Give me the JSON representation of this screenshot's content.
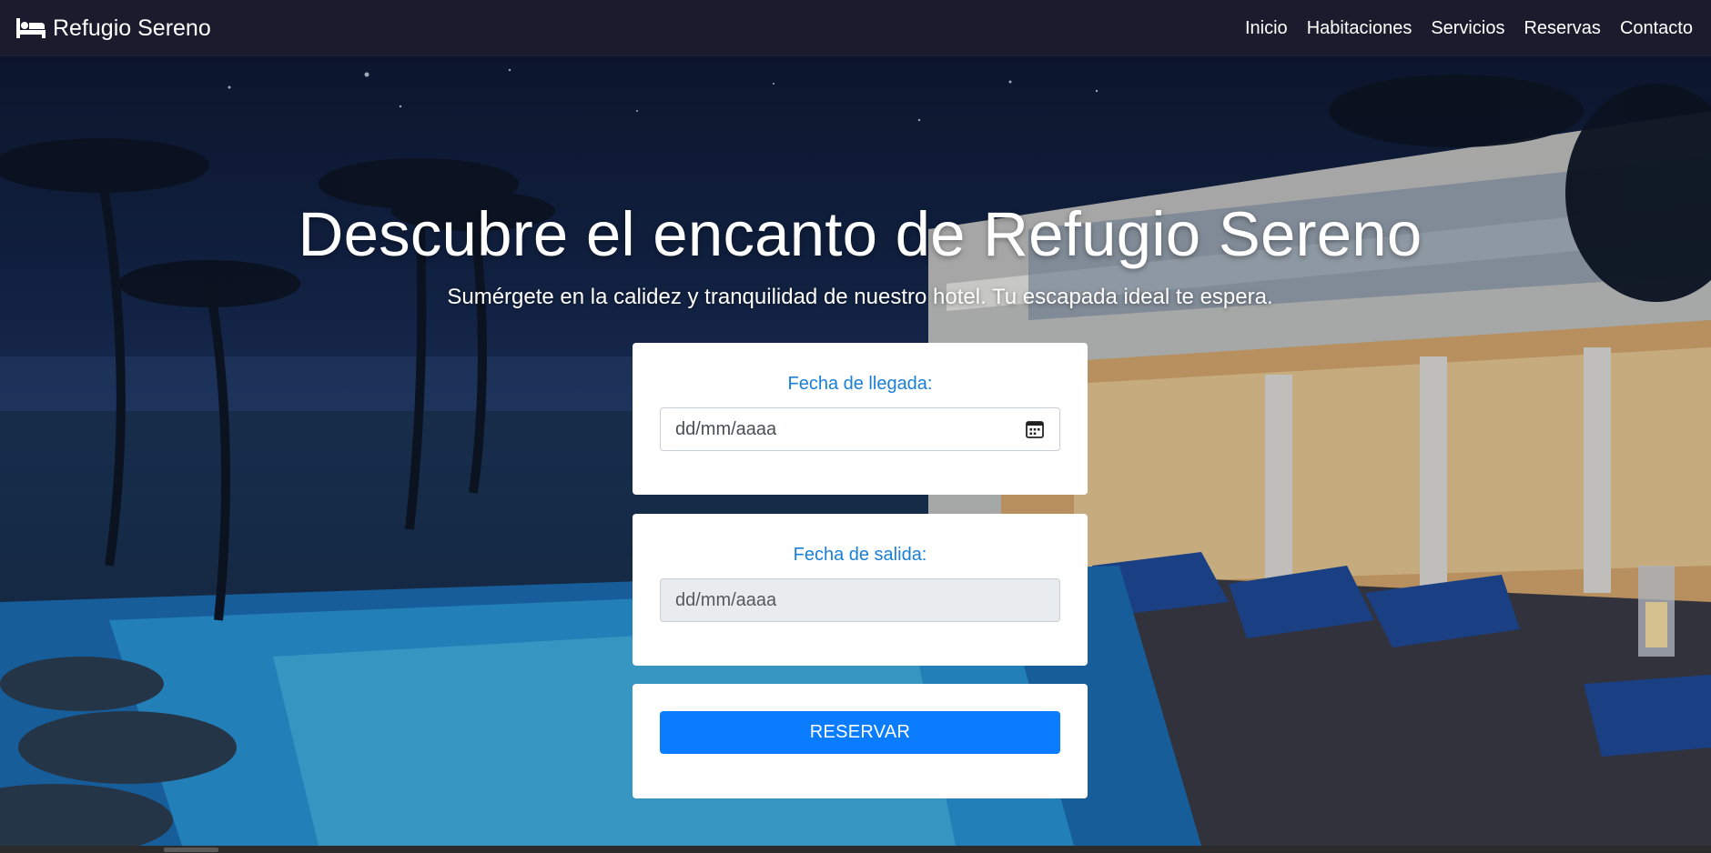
{
  "navbar": {
    "brand_icon": "bed-icon",
    "brand_name": "Refugio Sereno",
    "links": [
      "Inicio",
      "Habitaciones",
      "Servicios",
      "Reservas",
      "Contacto"
    ]
  },
  "hero": {
    "title": "Descubre el encanto de Refugio Sereno",
    "subtitle": "Sumérgete en la calidez y tranquilidad de nuestro hotel. Tu escapada ideal te espera."
  },
  "booking_form": {
    "arrival": {
      "label": "Fecha de llegada:",
      "placeholder": "dd/mm/aaaa",
      "icon": "calendar-icon"
    },
    "departure": {
      "label": "Fecha de salida:",
      "placeholder": "dd/mm/aaaa",
      "disabled": true
    },
    "submit_label": "RESERVAR"
  },
  "colors": {
    "navbar_bg": "#1c1b2d",
    "label_blue": "#1a7fd6",
    "button_blue": "#0a7cff",
    "disabled_input_bg": "#e9ecef"
  }
}
